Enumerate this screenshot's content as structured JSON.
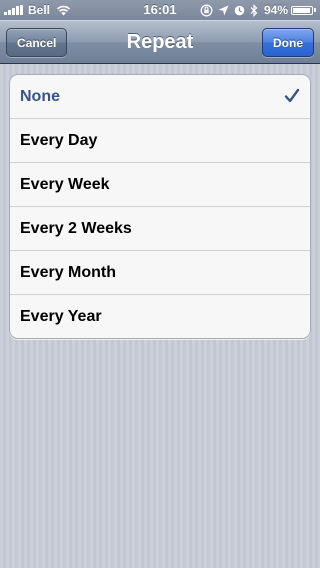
{
  "status_bar": {
    "carrier": "Bell",
    "time": "16:01",
    "battery_percent": "94%",
    "battery_level": 0.94,
    "icons": [
      "signal-bars",
      "wifi-icon",
      "rotation-lock-icon",
      "location-arrow-icon",
      "alarm-icon",
      "bluetooth-icon",
      "battery-icon"
    ]
  },
  "nav": {
    "title": "Repeat",
    "cancel_label": "Cancel",
    "done_label": "Done"
  },
  "options": [
    {
      "label": "None",
      "selected": true
    },
    {
      "label": "Every Day",
      "selected": false
    },
    {
      "label": "Every Week",
      "selected": false
    },
    {
      "label": "Every 2 Weeks",
      "selected": false
    },
    {
      "label": "Every Month",
      "selected": false
    },
    {
      "label": "Every Year",
      "selected": false
    }
  ],
  "colors": {
    "selected_text": "#385487",
    "done_button": "#376fd8",
    "nav_bar": "#8e9cb1",
    "background": "#c7cbd6"
  }
}
